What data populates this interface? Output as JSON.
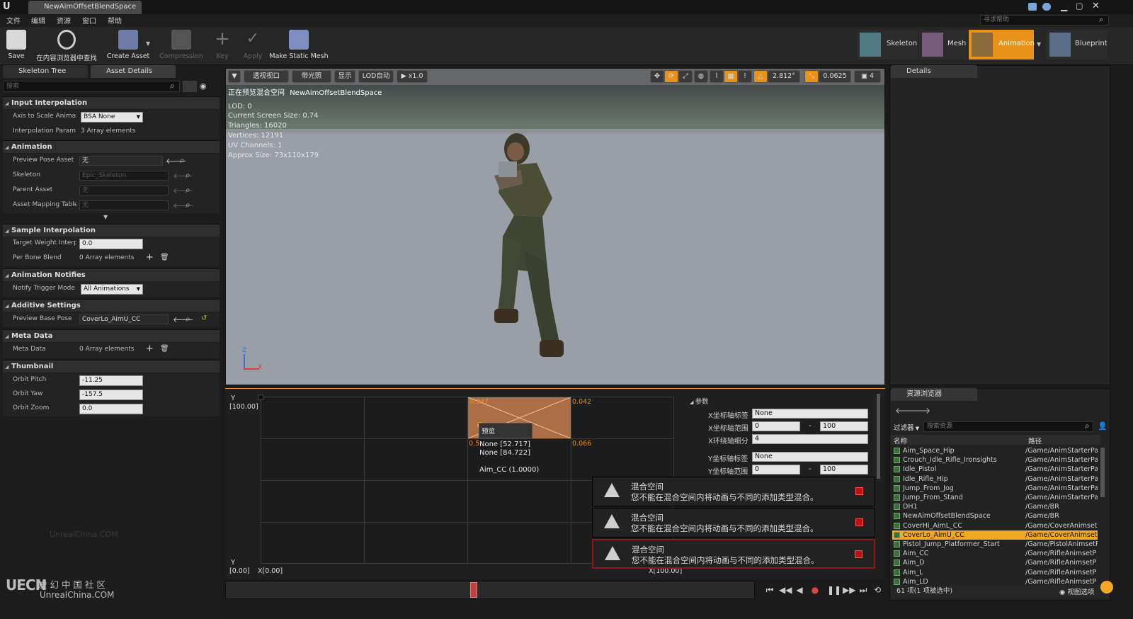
{
  "window": {
    "tab_title": "NewAimOffsetBlendSpace",
    "search_help": "寻求帮助"
  },
  "menu": [
    "文件",
    "编辑",
    "资源",
    "窗口",
    "帮助"
  ],
  "toolbar": {
    "save": "Save",
    "find": "在内容浏览器中查找",
    "create": "Create Asset",
    "compression": "Compression",
    "key": "Key",
    "apply": "Apply",
    "make_static": "Make Static Mesh"
  },
  "modes": {
    "skeleton": "Skeleton",
    "mesh": "Mesh",
    "animation": "Animation",
    "blueprint": "Blueprint"
  },
  "left_tabs": {
    "tab1": "Skeleton Tree",
    "tab2": "Asset Details",
    "search_placeholder": "搜索"
  },
  "sections": {
    "input": "Input Interpolation",
    "animation": "Animation",
    "sample": "Sample Interpolation",
    "notifies": "Animation Notifies",
    "additive": "Additive Settings",
    "meta": "Meta Data",
    "thumb": "Thumbnail"
  },
  "props": {
    "axis_scale": "Axis to Scale Animat",
    "axis_scale_val": "BSA None",
    "interp_param": "Interpolation Param",
    "interp_param_val": "3 Array elements",
    "preview_pose": "Preview Pose Asset",
    "preview_pose_val": "无",
    "skeleton": "Skeleton",
    "skeleton_val": "Epic_Skeleton",
    "parent": "Parent Asset",
    "parent_val": "无",
    "mapping": "Asset Mapping Table",
    "mapping_val": "无",
    "target_weight": "Target Weight Interpc",
    "target_weight_val": "0.0",
    "per_bone": "Per Bone Blend",
    "per_bone_val": "0 Array elements",
    "notify_mode": "Notify Trigger Mode",
    "notify_mode_val": "All Animations",
    "base_pose": "Preview Base Pose",
    "base_pose_val": "CoverLo_AimU_CC",
    "meta_data": "Meta Data",
    "meta_data_val": "0 Array elements",
    "orbit_pitch": "Orbit Pitch",
    "orbit_pitch_val": "-11.25",
    "orbit_yaw": "Orbit Yaw",
    "orbit_yaw_val": "-157.5",
    "orbit_zoom": "Orbit Zoom",
    "orbit_zoom_val": "0.0"
  },
  "viewport": {
    "btn_persp": "透视视口",
    "btn_lit": "带光照",
    "btn_show": "显示",
    "btn_lod": "LOD自动",
    "btn_speed": "x1.0",
    "angle": "2.812°",
    "scale": "0.0625",
    "cam": "4",
    "preview_label": "正在预览混合空间",
    "preview_asset": "NewAimOffsetBlendSpace",
    "stats": [
      "LOD: 0",
      "Current Screen Size: 0.74",
      "Triangles: 16020",
      "Vertices: 12191",
      "UV Channels: 1",
      "Approx Size: 73x110x179"
    ],
    "axis_x": "X",
    "axis_z": "Z"
  },
  "details_tab": "Details",
  "blend": {
    "y_label": "Y",
    "y_max": "[100.00]",
    "y_min": "[0.00]",
    "y_bottom": "Y",
    "x_min": "X[0.00]",
    "x_max": "X[100.00]",
    "corner_tl": "0.347",
    "corner_tr": "0.042",
    "corner_bl": "0.5",
    "corner_br": "0.066",
    "tooltip_title": "预览",
    "tooltip_l1": "None [52.717]",
    "tooltip_l2": "None [84.722]",
    "tooltip_l3": "Aim_CC (1.0000)"
  },
  "params": {
    "header": "参数",
    "x_label": "X坐标轴标签",
    "x_label_val": "None",
    "x_range": "X坐标轴范围",
    "x_range_min": "0",
    "x_range_max": "100",
    "x_div": "X环绕轴细分",
    "x_div_val": "4",
    "y_label": "Y坐标轴标签",
    "y_label_val": "None",
    "y_range": "Y坐标轴范围",
    "y_range_min": "0",
    "y_range_max": "100",
    "dash": "-"
  },
  "toasts": [
    {
      "title": "混合空间",
      "msg": "您不能在混合空间内将动画与不同的添加类型混合。"
    },
    {
      "title": "混合空间",
      "msg": "您不能在混合空间内将动画与不同的添加类型混合。"
    },
    {
      "title": "混合空间",
      "msg": "您不能在混合空间内将动画与不同的添加类型混合。"
    }
  ],
  "content_browser": {
    "tab": "资源浏览器",
    "filter": "过滤器",
    "search_placeholder": "搜索资源",
    "col_name": "名称",
    "col_path": "路径",
    "rows": [
      {
        "name": "Aim_Space_Hip",
        "path": "/Game/AnimStarterPa"
      },
      {
        "name": "Crouch_Idle_Rifle_Ironsights",
        "path": "/Game/AnimStarterPa"
      },
      {
        "name": "Idle_Pistol",
        "path": "/Game/AnimStarterPa"
      },
      {
        "name": "Idle_Rifle_Hip",
        "path": "/Game/AnimStarterPa"
      },
      {
        "name": "Jump_From_Jog",
        "path": "/Game/AnimStarterPa"
      },
      {
        "name": "Jump_From_Stand",
        "path": "/Game/AnimStarterPa"
      },
      {
        "name": "DH1",
        "path": "/Game/BR"
      },
      {
        "name": "NewAimOffsetBlendSpace",
        "path": "/Game/BR"
      },
      {
        "name": "CoverHi_AimL_CC",
        "path": "/Game/CoverAnimsetI"
      },
      {
        "name": "CoverLo_AimU_CC",
        "path": "/Game/CoverAnimsetI"
      },
      {
        "name": "Pistol_Jump_Platformer_Start",
        "path": "/Game/PistolAnimsetP"
      },
      {
        "name": "Aim_CC",
        "path": "/Game/RifleAnimsetP"
      },
      {
        "name": "Aim_D",
        "path": "/Game/RifleAnimsetP"
      },
      {
        "name": "Aim_L",
        "path": "/Game/RifleAnimsetP"
      },
      {
        "name": "Aim_LD",
        "path": "/Game/RifleAnimsetP"
      }
    ],
    "status": "61 项(1 项被选中)",
    "view_options": "视图选项"
  },
  "watermark": {
    "logo": "UECN",
    "cn": "虚 幻 中 国 社 区",
    "url": "UnrealChina.COM",
    "faint": "UnrealChina.COM"
  },
  "colors": {
    "accent": "#f2a822",
    "selected_mode": "#e8921a",
    "error": "#b11111"
  }
}
